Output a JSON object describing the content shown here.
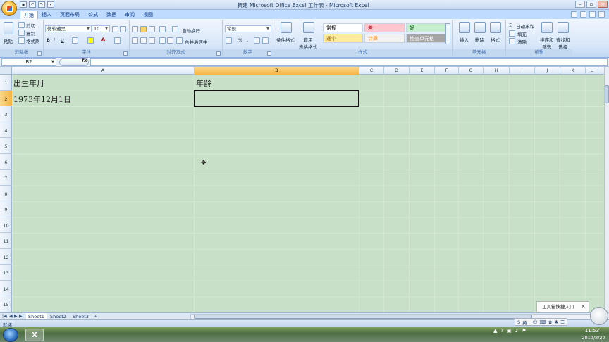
{
  "window": {
    "title": "新建 Microsoft Office Excel 工作表 - Microsoft Excel"
  },
  "tabs": [
    "开始",
    "插入",
    "页面布局",
    "公式",
    "数据",
    "审阅",
    "视图"
  ],
  "ribbon": {
    "clipboard": {
      "paste": "粘贴",
      "cut": "剪切",
      "copy": "复制",
      "format_painter": "格式刷",
      "label": "剪贴板"
    },
    "font": {
      "name": "微软雅黑",
      "size": "10",
      "label": "字体"
    },
    "alignment": {
      "wrap": "自动换行",
      "merge": "合并后居中",
      "label": "对齐方式"
    },
    "number": {
      "format": "常规",
      "label": "数字"
    },
    "styles": {
      "conditional": "条件格式",
      "table": "套用\n表格格式",
      "label": "样式",
      "cells": [
        {
          "text": "常规",
          "bg": "#ffffff",
          "fg": "#000000"
        },
        {
          "text": "差",
          "bg": "#ffc7ce",
          "fg": "#9c0006"
        },
        {
          "text": "好",
          "bg": "#c6efce",
          "fg": "#006100"
        },
        {
          "text": "适中",
          "bg": "#ffeb9c",
          "fg": "#9c6500"
        },
        {
          "text": "计算",
          "bg": "#f2f2f2",
          "fg": "#fa7d00"
        },
        {
          "text": "检查单元格",
          "bg": "#a5a5a5",
          "fg": "#ffffff"
        }
      ]
    },
    "cells": {
      "insert": "插入",
      "delete": "删除",
      "format": "格式",
      "label": "单元格"
    },
    "editing": {
      "autosum": "自动求和",
      "fill": "填充",
      "clear": "清除",
      "sort": "排序和\n筛选",
      "find": "查找和\n选择",
      "label": "编辑"
    }
  },
  "formula_bar": {
    "name_box": "B2",
    "fx": "fx",
    "value": ""
  },
  "columns": [
    "A",
    "B",
    "C",
    "D",
    "E",
    "F",
    "G",
    "H",
    "I",
    "J",
    "K",
    "L"
  ],
  "rows": [
    "1",
    "2",
    "3",
    "4",
    "5",
    "6",
    "7",
    "8",
    "9",
    "10",
    "11",
    "12",
    "13",
    "14",
    "15"
  ],
  "cells": {
    "A1": "出生年月",
    "B1": "年龄",
    "A2": "1973年12月1日"
  },
  "sheets": [
    "Sheet1",
    "Sheet2",
    "Sheet3"
  ],
  "status": {
    "ready": "就绪"
  },
  "toolbox": {
    "text": "工具箱快捷入口"
  },
  "ime": [
    "S",
    "英",
    "·",
    "☺",
    "⌨",
    "✿",
    "♣",
    "☰"
  ],
  "clock": {
    "time": "11:53",
    "date": "2019/8/22"
  },
  "colors": {
    "selected_header": "#f6b545",
    "sheet_bg": "#c7e0c7",
    "ribbon_tab": "#bfdbff"
  }
}
